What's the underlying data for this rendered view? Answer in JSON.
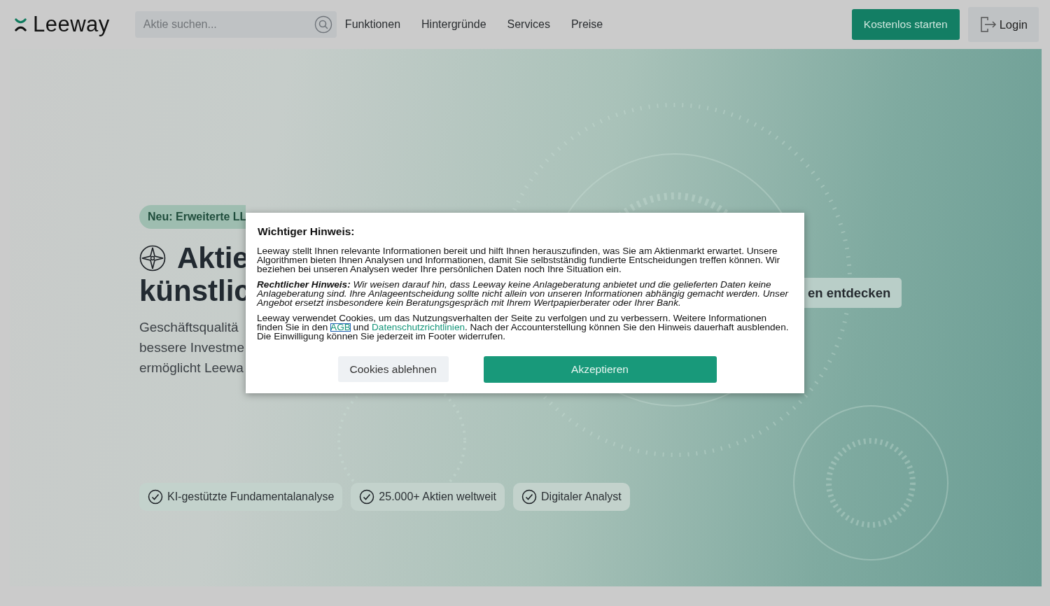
{
  "header": {
    "logo": "Leeway",
    "search": {
      "placeholder": "Aktie suchen..."
    },
    "nav": [
      "Funktionen",
      "Hintergründe",
      "Services",
      "Preise"
    ],
    "cta": "Kostenlos starten",
    "login": "Login"
  },
  "hero": {
    "badge": "Neu: Erweiterte LL",
    "title_lines": [
      "Aktie",
      "künstlic"
    ],
    "intro_lines": [
      "Geschäftsqualitä",
      "bessere Investme",
      "ermöglicht Leewa"
    ],
    "secondary_button": "en entdecken",
    "features": [
      "KI-gestützte Fundamentalanalyse",
      "25.000+ Aktien weltweit",
      "Digitaler Analyst"
    ]
  },
  "dialog": {
    "title": "Wichtiger Hinweis:",
    "paragraph_1": "Leeway stellt Ihnen relevante Informationen bereit und hilft Ihnen herauszufinden, was Sie am Aktienmarkt erwartet. Unsere Algorithmen bieten Ihnen Analysen und Informationen, damit Sie selbstständig fundierte Entscheidungen treffen können. Wir beziehen bei unseren Analysen weder Ihre persönlichen Daten noch Ihre Situation ein.",
    "paragraph_2": "**Rechtlicher Hinweis:** Wir weisen darauf hin, dass Leeway keine Anlageberatung anbietet und die gelieferten Daten keine Anlageberatung sind. Ihre Anlageentscheidung sollte nicht allein von unseren Informationen abhängig gemacht werden. Unser Angebot ersetzt insbesondere kein Beratungsgespräch mit Ihrem Wertpapierberater oder Ihrer Bank.",
    "paragraph_3": [
      {
        "kind": "text",
        "text": "Leeway verwendet Cookies, um das Nutzungsverhalten der Seite zu verfolgen und zu verbessern. Weitere Informationen finden Sie in den "
      },
      {
        "kind": "link",
        "text": "AGB",
        "focused": true
      },
      {
        "kind": "text",
        "text": " und "
      },
      {
        "kind": "link",
        "text": "Datenschutzrichtlinien",
        "focused": false
      },
      {
        "kind": "text",
        "text": ". Nach der Accounterstellung können Sie den Hinweis dauerhaft ausblenden. Die Einwilligung können Sie jederzeit im Footer widerrufen."
      }
    ],
    "decline": "Cookies ablehnen",
    "accept": "Akzeptieren"
  }
}
